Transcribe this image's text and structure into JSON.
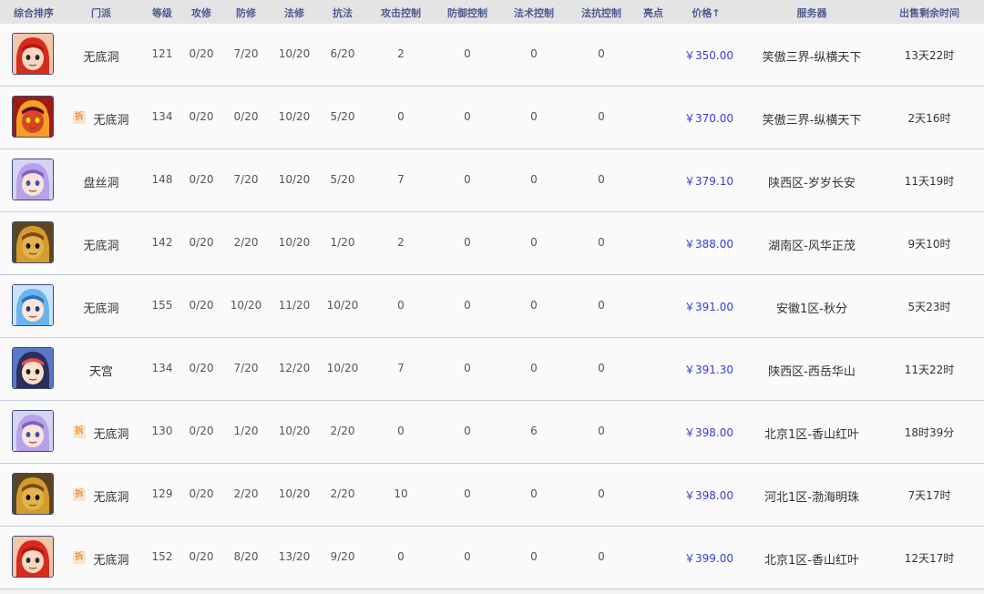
{
  "columns": {
    "rank": "综合排序",
    "menpai": "门派",
    "level": "等级",
    "attack_cult": "攻修",
    "defense_cult": "防修",
    "magic_cult": "法修",
    "resist_cult": "抗法",
    "attack_ctrl": "攻击控制",
    "defense_ctrl": "防御控制",
    "magic_ctrl": "法术控制",
    "resist_ctrl": "法抗控制",
    "highlight": "亮点",
    "price": "价格",
    "sort_arrow": "↑",
    "server": "服务器",
    "time_left": "出售剩余时间"
  },
  "colors": {
    "header_text": "#4d5c8f",
    "price": "#3b3bd8",
    "tag_bg": "#fbe3c8",
    "tag_text": "#e2721b"
  },
  "rows": [
    {
      "avatar": "red-hair-character",
      "tag": "",
      "menpai": "无底洞",
      "level": "121",
      "attack_cult": "0/20",
      "defense_cult": "7/20",
      "magic_cult": "10/20",
      "resist_cult": "6/20",
      "attack_ctrl": "2",
      "defense_ctrl": "0",
      "magic_ctrl": "0",
      "resist_ctrl": "0",
      "price": "￥350.00",
      "server": "笑傲三界-纵横天下",
      "time_left": "13天22时"
    },
    {
      "avatar": "demon-character",
      "tag": "拆",
      "menpai": "无底洞",
      "level": "134",
      "attack_cult": "0/20",
      "defense_cult": "0/20",
      "magic_cult": "10/20",
      "resist_cult": "5/20",
      "attack_ctrl": "0",
      "defense_ctrl": "0",
      "magic_ctrl": "0",
      "resist_ctrl": "0",
      "price": "￥370.00",
      "server": "笑傲三界-纵横天下",
      "time_left": "2天16时"
    },
    {
      "avatar": "purple-hair-character",
      "tag": "",
      "menpai": "盘丝洞",
      "level": "148",
      "attack_cult": "0/20",
      "defense_cult": "7/20",
      "magic_cult": "10/20",
      "resist_cult": "5/20",
      "attack_ctrl": "7",
      "defense_ctrl": "0",
      "magic_ctrl": "0",
      "resist_ctrl": "0",
      "price": "￥379.10",
      "server": "陕西区-岁岁长安",
      "time_left": "11天19时"
    },
    {
      "avatar": "tiger-character",
      "tag": "",
      "menpai": "无底洞",
      "level": "142",
      "attack_cult": "0/20",
      "defense_cult": "2/20",
      "magic_cult": "10/20",
      "resist_cult": "1/20",
      "attack_ctrl": "2",
      "defense_ctrl": "0",
      "magic_ctrl": "0",
      "resist_ctrl": "0",
      "price": "￥388.00",
      "server": "湖南区-风华正茂",
      "time_left": "9天10时"
    },
    {
      "avatar": "blue-hair-character",
      "tag": "",
      "menpai": "无底洞",
      "level": "155",
      "attack_cult": "0/20",
      "defense_cult": "10/20",
      "magic_cult": "11/20",
      "resist_cult": "10/20",
      "attack_ctrl": "0",
      "defense_ctrl": "0",
      "magic_ctrl": "0",
      "resist_ctrl": "0",
      "price": "￥391.00",
      "server": "安徽1区-秋分",
      "time_left": "5天23时"
    },
    {
      "avatar": "dark-hair-character",
      "tag": "",
      "menpai": "天宫",
      "level": "134",
      "attack_cult": "0/20",
      "defense_cult": "7/20",
      "magic_cult": "12/20",
      "resist_cult": "10/20",
      "attack_ctrl": "7",
      "defense_ctrl": "0",
      "magic_ctrl": "0",
      "resist_ctrl": "0",
      "price": "￥391.30",
      "server": "陕西区-西岳华山",
      "time_left": "11天22时"
    },
    {
      "avatar": "purple-hair-character",
      "tag": "拆",
      "menpai": "无底洞",
      "level": "130",
      "attack_cult": "0/20",
      "defense_cult": "1/20",
      "magic_cult": "10/20",
      "resist_cult": "2/20",
      "attack_ctrl": "0",
      "defense_ctrl": "0",
      "magic_ctrl": "6",
      "resist_ctrl": "0",
      "price": "￥398.00",
      "server": "北京1区-香山红叶",
      "time_left": "18时39分"
    },
    {
      "avatar": "tiger-character",
      "tag": "拆",
      "menpai": "无底洞",
      "level": "129",
      "attack_cult": "0/20",
      "defense_cult": "2/20",
      "magic_cult": "10/20",
      "resist_cult": "2/20",
      "attack_ctrl": "10",
      "defense_ctrl": "0",
      "magic_ctrl": "0",
      "resist_ctrl": "0",
      "price": "￥398.00",
      "server": "河北1区-渤海明珠",
      "time_left": "7天17时"
    },
    {
      "avatar": "red-hair-character",
      "tag": "拆",
      "menpai": "无底洞",
      "level": "152",
      "attack_cult": "0/20",
      "defense_cult": "8/20",
      "magic_cult": "13/20",
      "resist_cult": "9/20",
      "attack_ctrl": "0",
      "defense_ctrl": "0",
      "magic_ctrl": "0",
      "resist_ctrl": "0",
      "price": "￥399.00",
      "server": "北京1区-香山红叶",
      "time_left": "12天17时"
    }
  ]
}
